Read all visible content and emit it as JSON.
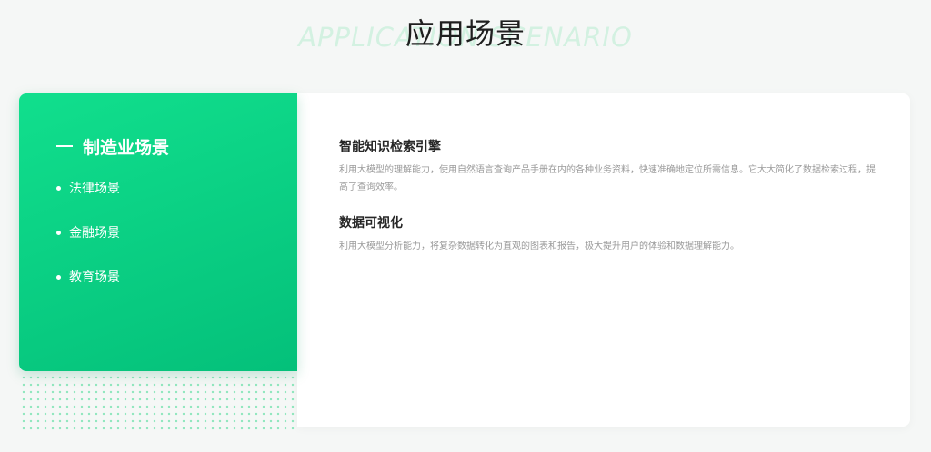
{
  "section": {
    "title": "应用场景",
    "bg_title": "APPLICATION SCENARIO"
  },
  "tabs": {
    "active": "制造业场景",
    "items": [
      {
        "label": "法律场景"
      },
      {
        "label": "金融场景"
      },
      {
        "label": "教育场景"
      }
    ]
  },
  "content": {
    "items": [
      {
        "title": "智能知识检索引擎",
        "desc": "利用大模型的理解能力，使用自然语言查询产品手册在内的各种业务资料，快速准确地定位所需信息。它大大简化了数据检索过程，提高了查询效率。"
      },
      {
        "title": "数据可视化",
        "desc": "利用大模型分析能力，将复杂数据转化为直观的图表和报告，极大提升用户的体验和数据理解能力。"
      }
    ]
  },
  "colors": {
    "accent": "#0fd98a",
    "accent_dark": "#04c07a",
    "watermark": "#d3f1e1"
  }
}
